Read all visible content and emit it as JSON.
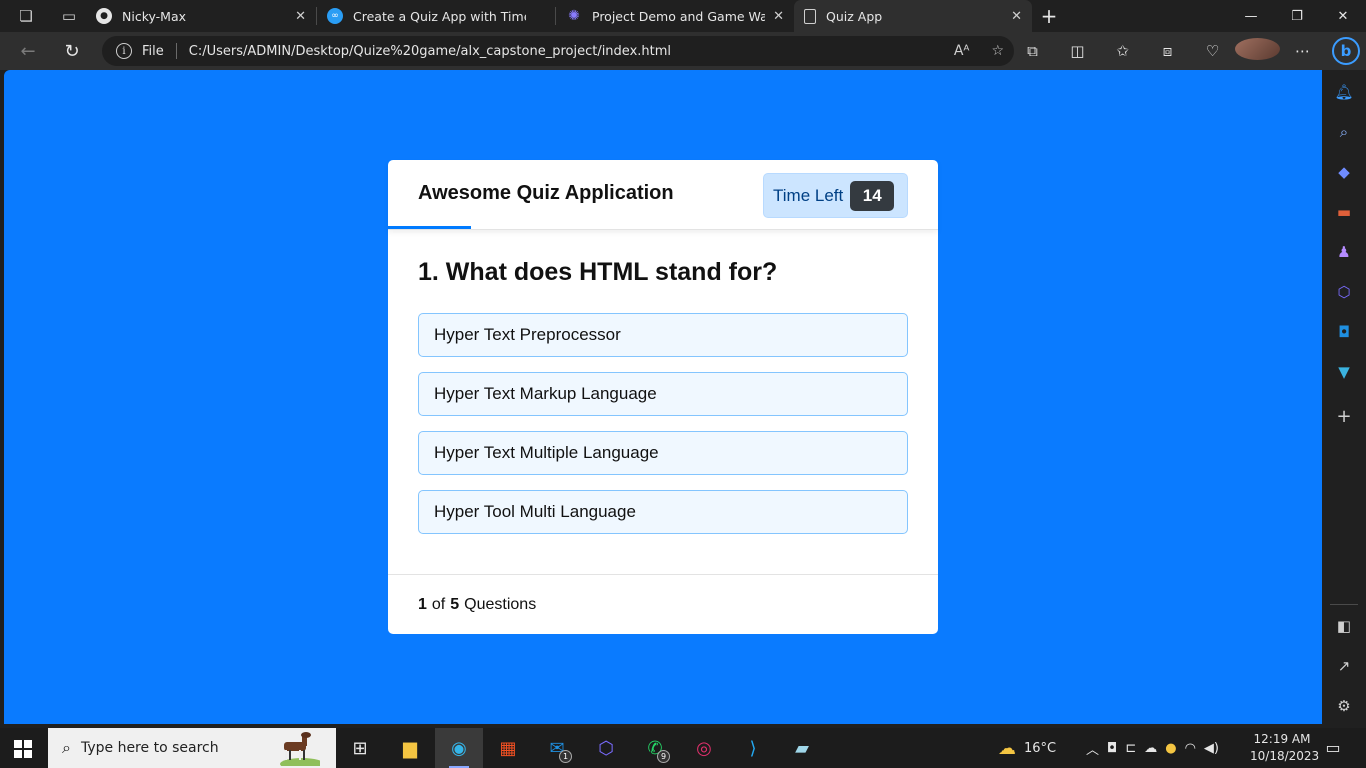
{
  "browser": {
    "tabs": [
      {
        "title": "Nicky-Max",
        "active": false
      },
      {
        "title": "Create a Quiz App with Timer usi",
        "active": false
      },
      {
        "title": "Project Demo and Game Walkthr",
        "active": false
      },
      {
        "title": "Quiz App",
        "active": true
      }
    ],
    "address": {
      "scheme_label": "File",
      "url": "C:/Users/ADMIN/Desktop/Quize%20game/alx_capstone_project/index.html"
    }
  },
  "quiz": {
    "title": "Awesome Quiz Application",
    "timer_label": "Time Left",
    "timer_seconds": "14",
    "question": "1. What does HTML stand for?",
    "options": [
      "Hyper Text Preprocessor",
      "Hyper Text Markup Language",
      "Hyper Text Multiple Language",
      "Hyper Tool Multi Language"
    ],
    "footer": {
      "current": "1",
      "of_text": "of",
      "total": "5",
      "suffix": "Questions"
    },
    "accent_color": "#007bff",
    "page_background": "#0a7bff"
  },
  "taskbar": {
    "search_placeholder": "Type here to search",
    "weather": "16°C",
    "time": "12:19 AM",
    "date": "10/18/2023",
    "mail_badge": "1",
    "whatsapp_badge": "9"
  }
}
